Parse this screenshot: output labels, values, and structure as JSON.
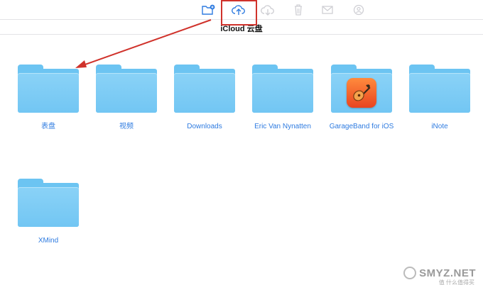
{
  "toolbar": {
    "icons": [
      {
        "name": "new-folder-icon",
        "state": "active"
      },
      {
        "name": "upload-icon",
        "state": "active"
      },
      {
        "name": "download-icon",
        "state": "disabled"
      },
      {
        "name": "trash-icon",
        "state": "disabled"
      },
      {
        "name": "mail-icon",
        "state": "disabled"
      },
      {
        "name": "share-icon",
        "state": "disabled"
      }
    ]
  },
  "header": {
    "title": "iCloud 云盘"
  },
  "folders": [
    {
      "label": "表盘"
    },
    {
      "label": "视频"
    },
    {
      "label": "Downloads"
    },
    {
      "label": "Eric Van Nynatten"
    },
    {
      "label": "GarageBand for iOS",
      "app_icon": "garageband-icon"
    },
    {
      "label": "iNote"
    },
    {
      "label": "XMind"
    }
  ],
  "watermark": {
    "text": "SMYZ.NET",
    "sub": "值 什么值得买"
  },
  "colors": {
    "accent": "#2e7be0",
    "folder": "#72c6f3",
    "annotation": "#d0322b"
  }
}
